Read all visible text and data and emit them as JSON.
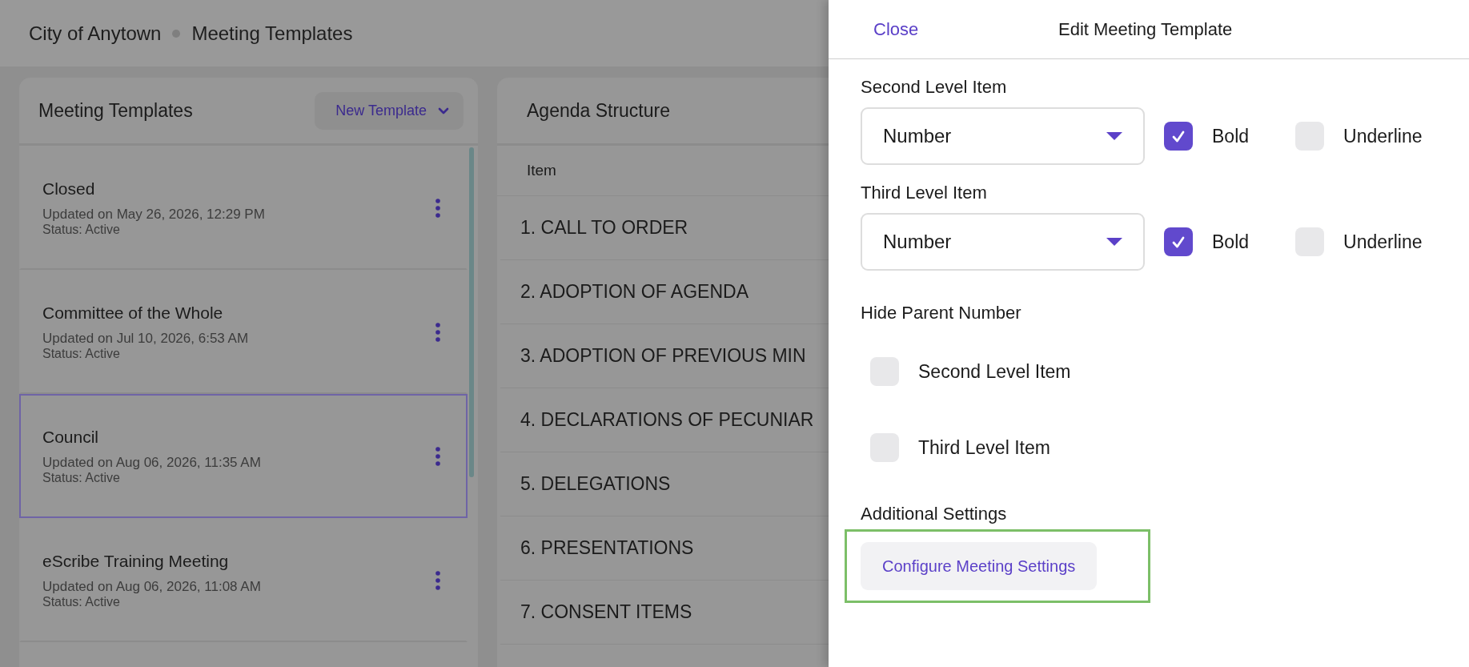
{
  "breadcrumb": [
    "City of Anytown",
    "Meeting Templates"
  ],
  "templates_panel": {
    "title": "Meeting Templates",
    "new_button": "New Template",
    "items": [
      {
        "name": "Closed",
        "updated": "Updated on May 26, 2026, 12:29 PM",
        "status": "Status: Active",
        "selected": false
      },
      {
        "name": "Committee of the Whole",
        "updated": "Updated on Jul 10, 2026, 6:53 AM",
        "status": "Status: Active",
        "selected": false
      },
      {
        "name": "Council",
        "updated": "Updated on Aug 06, 2026, 11:35 AM",
        "status": "Status: Active",
        "selected": true
      },
      {
        "name": "eScribe Training Meeting",
        "updated": "Updated on Aug 06, 2026, 11:08 AM",
        "status": "Status: Active",
        "selected": false
      }
    ]
  },
  "agenda_panel": {
    "title": "Agenda Structure",
    "column": "Item",
    "rows": [
      "1. CALL TO ORDER",
      "2. ADOPTION OF AGENDA",
      "3. ADOPTION OF PREVIOUS MIN",
      "4. DECLARATIONS OF PECUNIAR",
      "5. DELEGATIONS",
      "6. PRESENTATIONS",
      "7. CONSENT ITEMS"
    ]
  },
  "drawer": {
    "close": "Close",
    "title": "Edit Meeting Template",
    "levels": [
      {
        "label": "Second Level Item",
        "select": "Number",
        "options": [
          {
            "label": "Bold",
            "checked": true
          },
          {
            "label": "Underline",
            "checked": false
          }
        ]
      },
      {
        "label": "Third Level Item",
        "select": "Number",
        "options": [
          {
            "label": "Bold",
            "checked": true
          },
          {
            "label": "Underline",
            "checked": false
          }
        ]
      }
    ],
    "hide_parent": {
      "label": "Hide Parent Number",
      "items": [
        {
          "label": "Second Level Item",
          "checked": false
        },
        {
          "label": "Third Level Item",
          "checked": false
        }
      ]
    },
    "additional": {
      "label": "Additional Settings",
      "button": "Configure Meeting Settings",
      "highlighted": true
    }
  }
}
